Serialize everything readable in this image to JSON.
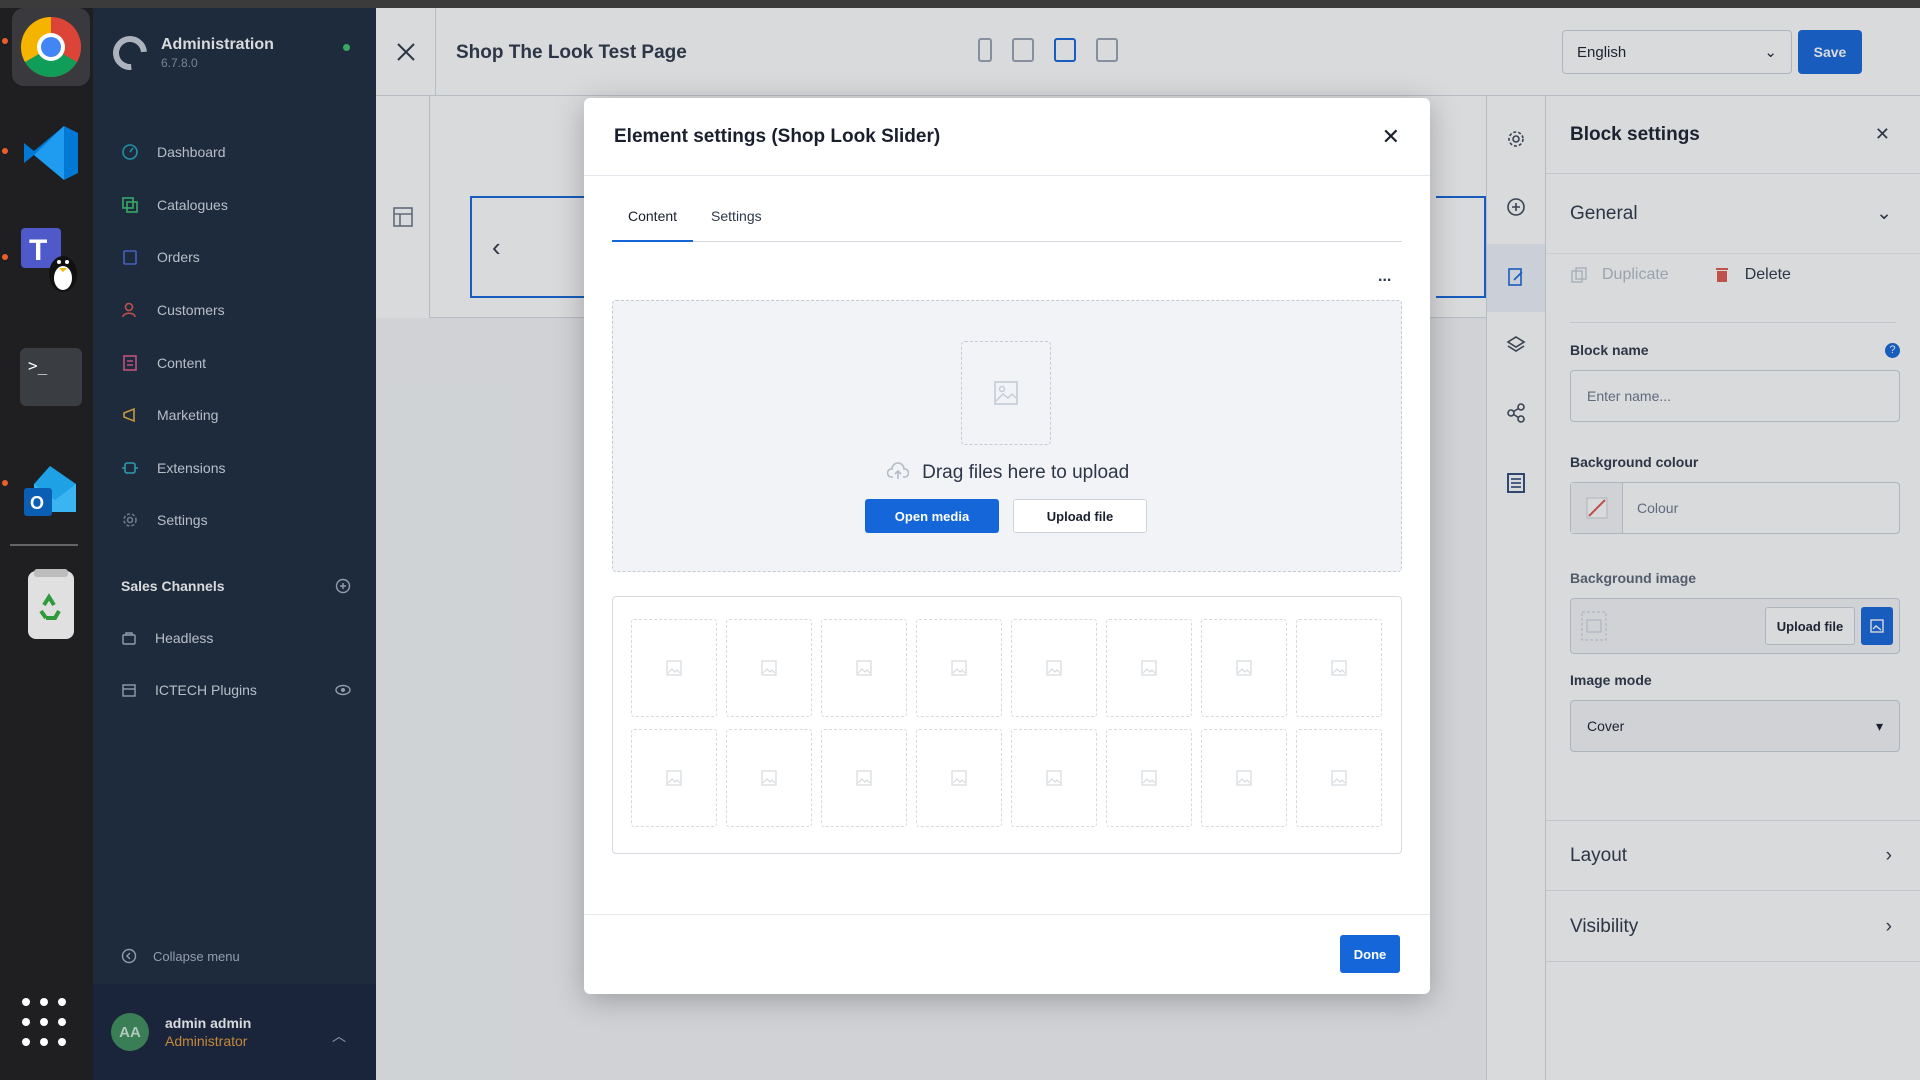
{
  "dock": {
    "apps": [
      "chrome-icon",
      "vscode-icon",
      "teams-linux-icon",
      "terminal-icon",
      "outlook-icon",
      "trash-icon"
    ],
    "grid_icon": "apps-grid-icon"
  },
  "sidebar": {
    "brand_title": "Administration",
    "brand_version": "6.7.8.0",
    "nav": [
      {
        "label": "Dashboard",
        "icon": "dashboard-icon",
        "color": "#1ea6bf"
      },
      {
        "label": "Catalogues",
        "icon": "catalogues-icon",
        "color": "#3bc46e"
      },
      {
        "label": "Orders",
        "icon": "orders-icon",
        "color": "#4e6bd9"
      },
      {
        "label": "Customers",
        "icon": "customers-icon",
        "color": "#e0574e"
      },
      {
        "label": "Content",
        "icon": "content-icon",
        "color": "#e05a8a"
      },
      {
        "label": "Marketing",
        "icon": "marketing-icon",
        "color": "#e8b23a"
      },
      {
        "label": "Extensions",
        "icon": "extensions-icon",
        "color": "#2bb3c7"
      },
      {
        "label": "Settings",
        "icon": "settings-icon",
        "color": "#7c8796"
      }
    ],
    "sales_channels_label": "Sales Channels",
    "sales_channels": [
      {
        "label": "Headless",
        "icon": "headless-icon"
      },
      {
        "label": "ICTECH Plugins",
        "icon": "storefront-icon"
      }
    ],
    "collapse_label": "Collapse menu",
    "user": {
      "initials": "AA",
      "name": "admin admin",
      "role": "Administrator"
    }
  },
  "header": {
    "page_title": "Shop The Look Test Page",
    "language": "English",
    "save_label": "Save"
  },
  "block_settings": {
    "title": "Block settings",
    "general_label": "General",
    "duplicate_label": "Duplicate",
    "delete_label": "Delete",
    "block_name_label": "Block name",
    "block_name_placeholder": "Enter name...",
    "bg_colour_label": "Background colour",
    "bg_colour_placeholder": "Colour",
    "bg_image_label": "Background image",
    "upload_file_label": "Upload file",
    "image_mode_label": "Image mode",
    "image_mode_value": "Cover",
    "layout_label": "Layout",
    "visibility_label": "Visibility"
  },
  "modal": {
    "title": "Element settings (Shop Look Slider)",
    "tabs": [
      "Content",
      "Settings"
    ],
    "active_tab": "Content",
    "more_label": "...",
    "drag_text": "Drag files here to upload",
    "open_media_label": "Open media",
    "upload_file_label": "Upload file",
    "done_label": "Done"
  },
  "colors": {
    "accent": "#1466d9",
    "sidebar_bg": "#1b2a3d",
    "role_color": "#e59b3a"
  }
}
